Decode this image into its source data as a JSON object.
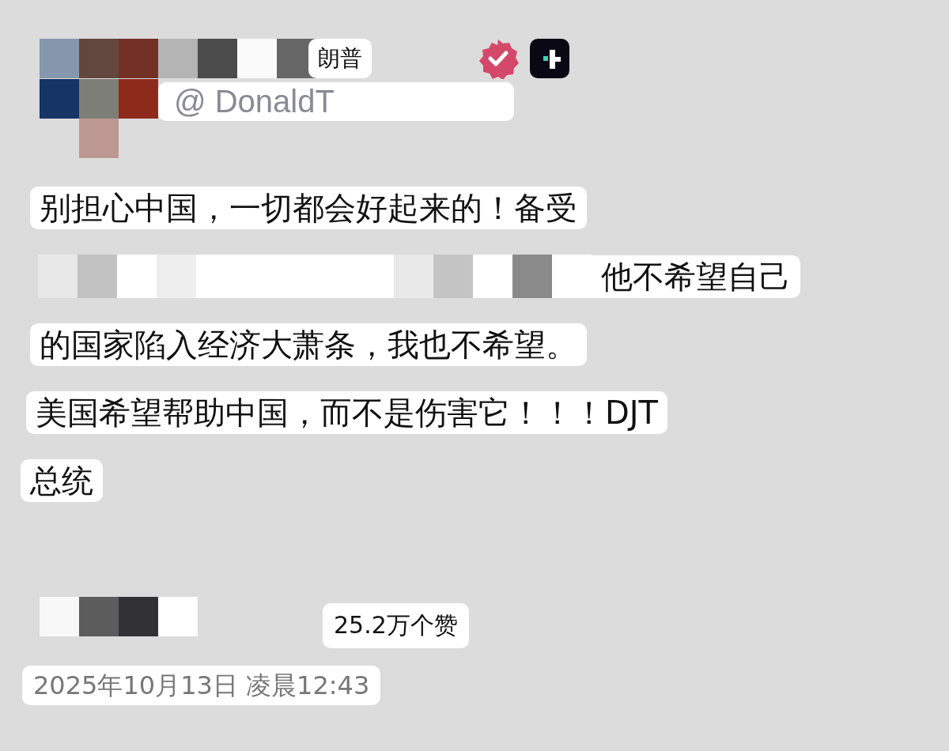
{
  "author": {
    "name": "朗普",
    "handle": "@ DonaldT",
    "verified": true
  },
  "post": {
    "lines": [
      {
        "text": "别担心中国，一切都会好起来的！备受",
        "masked": false
      },
      {
        "text": "他不希望自己",
        "masked": true
      },
      {
        "text": "的国家陷入经济大萧条，我也不希望。",
        "masked": false
      },
      {
        "text": "美国希望帮助中国，而不是伤害它！！！DJT",
        "masked": false
      },
      {
        "text": "总统",
        "masked": false
      }
    ]
  },
  "likes": "25.2万个赞",
  "timestamp": "2025年10月13日 凌晨12:43"
}
